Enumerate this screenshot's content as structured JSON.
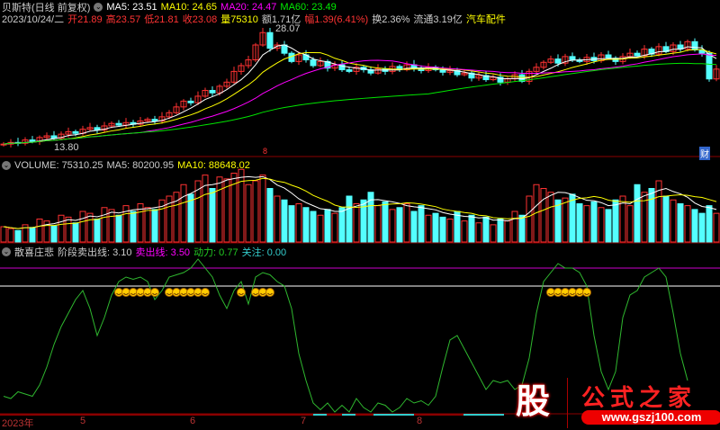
{
  "header": {
    "title": "贝斯特(日线 前复权)",
    "ma5": "MA5: 23.51",
    "ma10": "MA10: 24.65",
    "ma20": "MA20: 24.47",
    "ma60": "MA60: 23.49",
    "date": "2023/10/24/二",
    "open": "开21.89",
    "high": "高23.57",
    "low": "低21.81",
    "close": "收23.08",
    "vol": "量75310",
    "amount": "额1.71亿",
    "change": "幅1.39(6.41%)",
    "turnover": "换2.36%",
    "float": "流通3.19亿",
    "sector": "汽车配件"
  },
  "main_panel": {
    "high_label": "28.07",
    "low_label": "13.80",
    "marker": "8",
    "finance_badge": "财"
  },
  "volume_panel": {
    "volume": "VOLUME: 75310.25",
    "ma5": "MA5: 80200.95",
    "ma10": "MA10: 88648.02"
  },
  "indicator_panel": {
    "name": "散喜庄悲",
    "line1": "阶段卖出线: 3.10",
    "line2": "卖出线: 3.50",
    "line3": "动力: 0.77",
    "line4": "关注: 0.00"
  },
  "xaxis": [
    "2023年",
    "5",
    "6",
    "7",
    "8"
  ],
  "logo": {
    "text": "公式之家",
    "char": "股",
    "url": "www.gszj100.com"
  },
  "colors": {
    "up": "#ff3232",
    "down": "#54ffff",
    "ma5": "#ffffff",
    "ma10": "#ffff00",
    "ma20": "#ff00ff",
    "ma60": "#00e600",
    "indicator": "#2fb82f"
  },
  "chart_data": {
    "type": "candlestick",
    "closes": [
      14.0,
      14.2,
      14.1,
      14.5,
      14.3,
      14.8,
      15.0,
      14.7,
      15.2,
      15.5,
      15.3,
      15.8,
      16.0,
      15.7,
      16.2,
      16.5,
      16.3,
      16.6,
      16.4,
      16.8,
      17.0,
      16.8,
      17.3,
      17.8,
      18.5,
      19.2,
      19.0,
      19.8,
      20.5,
      20.2,
      21.0,
      21.5,
      22.8,
      23.5,
      24.2,
      26.0,
      27.5,
      25.6,
      26.0,
      25.0,
      24.0,
      24.8,
      24.2,
      23.5,
      24.0,
      23.2,
      23.6,
      23.0,
      22.8,
      23.3,
      23.0,
      22.6,
      23.1,
      22.8,
      23.4,
      23.0,
      23.6,
      23.2,
      22.9,
      23.3,
      23.0,
      22.7,
      22.9,
      22.4,
      22.6,
      22.0,
      22.3,
      21.8,
      22.1,
      21.5,
      21.9,
      22.4,
      21.6,
      22.8,
      23.3,
      23.9,
      24.3,
      23.8,
      24.6,
      24.2,
      24.0,
      24.5,
      24.1,
      24.8,
      24.4,
      24.0,
      24.6,
      25.0,
      24.7,
      25.5,
      24.9,
      25.8,
      25.2,
      26.0,
      25.5,
      26.4,
      25.4,
      25.0,
      21.89,
      23.08
    ],
    "price_range": [
      13.8,
      28.07
    ],
    "volumes": [
      40,
      35,
      30,
      45,
      38,
      60,
      55,
      42,
      70,
      65,
      50,
      80,
      75,
      60,
      90,
      85,
      70,
      95,
      80,
      100,
      90,
      85,
      110,
      120,
      130,
      150,
      125,
      160,
      175,
      140,
      170,
      165,
      180,
      190,
      150,
      160,
      175,
      140,
      120,
      110,
      95,
      100,
      90,
      80,
      70,
      85,
      75,
      90,
      120,
      100,
      110,
      130,
      95,
      105,
      85,
      90,
      100,
      80,
      95,
      70,
      75,
      65,
      60,
      80,
      55,
      70,
      50,
      65,
      45,
      60,
      55,
      80,
      70,
      120,
      150,
      140,
      130,
      110,
      115,
      125,
      100,
      95,
      105,
      90,
      85,
      110,
      120,
      95,
      150,
      130,
      140,
      160,
      120,
      110,
      100,
      95,
      85,
      75,
      95,
      75
    ],
    "volume_max": 200,
    "indicator": [
      0.65,
      0.6,
      0.75,
      0.7,
      0.65,
      0.9,
      1.3,
      1.8,
      2.2,
      2.5,
      2.8,
      3.0,
      2.6,
      2.0,
      2.4,
      2.9,
      3.2,
      3.3,
      3.25,
      3.3,
      3.2,
      2.8,
      3.0,
      3.3,
      3.35,
      3.4,
      3.5,
      3.7,
      3.5,
      3.3,
      2.9,
      2.6,
      3.0,
      3.2,
      2.7,
      3.3,
      3.4,
      3.35,
      3.2,
      3.1,
      2.6,
      1.6,
      1.0,
      0.5,
      0.35,
      0.5,
      0.3,
      0.45,
      0.3,
      0.6,
      0.4,
      0.3,
      0.5,
      0.45,
      0.3,
      0.4,
      0.6,
      0.5,
      0.55,
      0.45,
      0.65,
      1.3,
      1.9,
      2.0,
      1.7,
      1.4,
      1.1,
      0.8,
      1.0,
      0.95,
      1.0,
      0.8,
      0.9,
      1.5,
      2.5,
      3.2,
      3.4,
      3.6,
      3.5,
      3.5,
      3.4,
      3.1,
      2.0,
      1.2,
      0.8,
      1.2,
      2.4,
      2.9,
      3.0,
      3.3,
      3.4,
      3.5,
      3.3,
      2.5,
      1.6,
      1.0
    ],
    "sell_line": 3.5,
    "stage_sell_line": 3.1,
    "signal_bars": [
      16,
      17,
      18,
      19,
      20,
      21,
      23,
      24,
      25,
      26,
      27,
      28,
      33,
      35,
      36,
      37,
      76,
      77,
      78,
      79,
      80,
      81
    ]
  }
}
